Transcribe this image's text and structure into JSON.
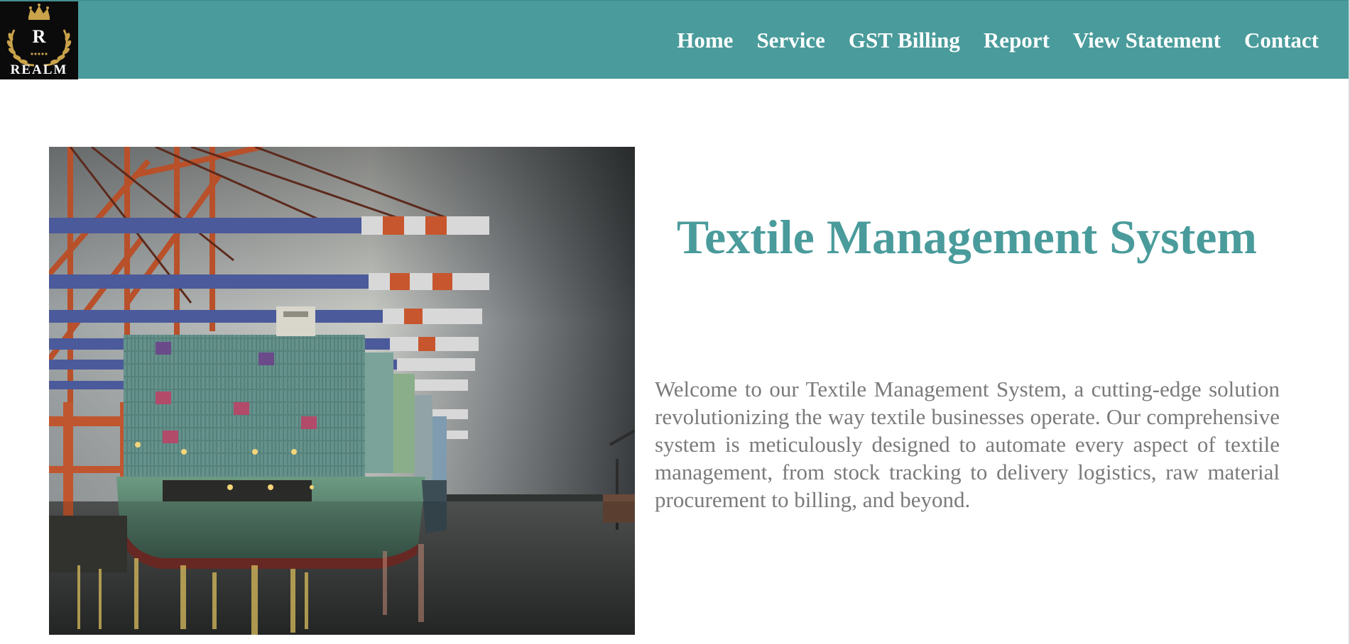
{
  "header": {
    "logo": {
      "monogram": "R",
      "wordmark": "REALM"
    },
    "nav": [
      {
        "label": "Home"
      },
      {
        "label": "Service"
      },
      {
        "label": "GST Billing"
      },
      {
        "label": "Report"
      },
      {
        "label": "View Statement"
      },
      {
        "label": "Contact"
      }
    ]
  },
  "hero": {
    "image_subject": "container-ship-at-port-with-cranes",
    "title": "Textile Management System",
    "description": "Welcome to our Textile Management System, a cutting-edge solution revolutionizing the way textile businesses operate. Our comprehensive system is meticulously designed to automate every aspect of textile management, from stock tracking to delivery logistics, raw material procurement to billing, and beyond."
  },
  "colors": {
    "header_bg": "#4a9b9b",
    "title": "#4a9b9b",
    "body_text": "#7a7a7a",
    "logo_bg": "#0b0b0b",
    "logo_gold": "#c9a24a"
  }
}
